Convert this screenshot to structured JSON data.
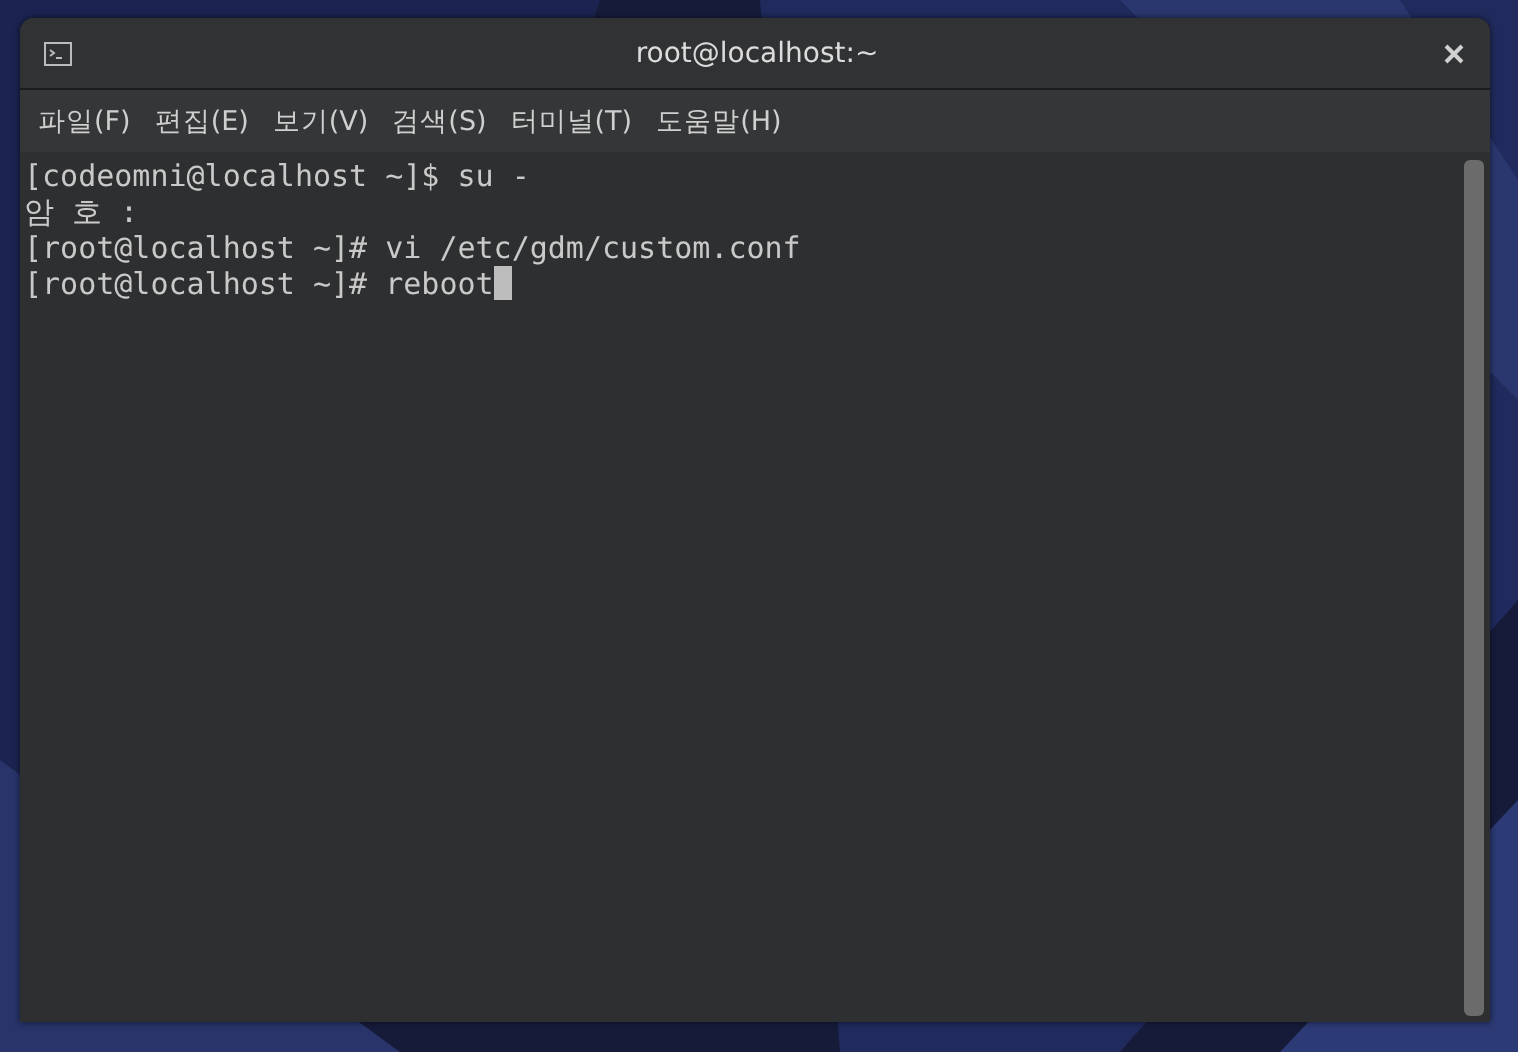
{
  "window": {
    "title": "root@localhost:~"
  },
  "menu": [
    {
      "label": "파일(F)"
    },
    {
      "label": "편집(E)"
    },
    {
      "label": "보기(V)"
    },
    {
      "label": "검색(S)"
    },
    {
      "label": "터미널(T)"
    },
    {
      "label": "도움말(H)"
    }
  ],
  "terminal": {
    "lines": [
      {
        "text": "[codeomni@localhost ~]$ su -",
        "cursor": false
      },
      {
        "text": "암 호 :",
        "cursor": false
      },
      {
        "text": "[root@localhost ~]# vi /etc/gdm/custom.conf",
        "cursor": false
      },
      {
        "text": "[root@localhost ~]# reboot",
        "cursor": true
      }
    ]
  }
}
